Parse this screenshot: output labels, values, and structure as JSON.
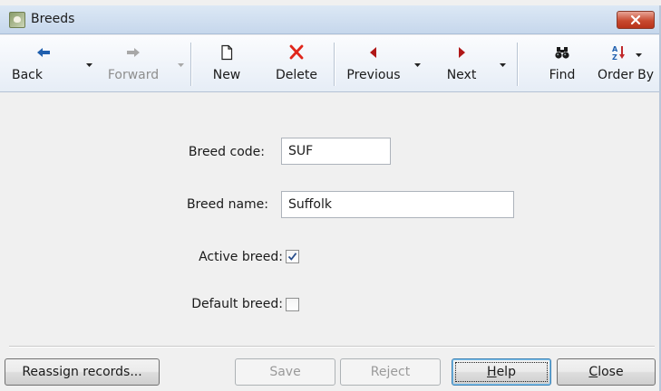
{
  "window": {
    "title": "Breeds",
    "icon": "sheep-app-icon"
  },
  "toolbar": {
    "back_label": "Back",
    "forward_label": "Forward",
    "new_label": "New",
    "delete_label": "Delete",
    "previous_label": "Previous",
    "next_label": "Next",
    "find_label": "Find",
    "order_by_label": "Order By"
  },
  "form": {
    "breed_code_label": "Breed code:",
    "breed_code_value": "SUF",
    "breed_name_label": "Breed name:",
    "breed_name_value": "Suffolk",
    "active_breed_label": "Active breed:",
    "active_breed_checked": true,
    "default_breed_label": "Default breed:",
    "default_breed_checked": false
  },
  "buttons": {
    "reassign_label": "Reassign records...",
    "save_label": "Save",
    "reject_label": "Reject",
    "help_label": "Help",
    "help_mnemonic": "H",
    "close_label": "Close",
    "close_mnemonic": "C"
  },
  "colors": {
    "back_arrow": "#1f5fae",
    "delete_x": "#e0261b",
    "nav_triangle": "#b01818"
  }
}
